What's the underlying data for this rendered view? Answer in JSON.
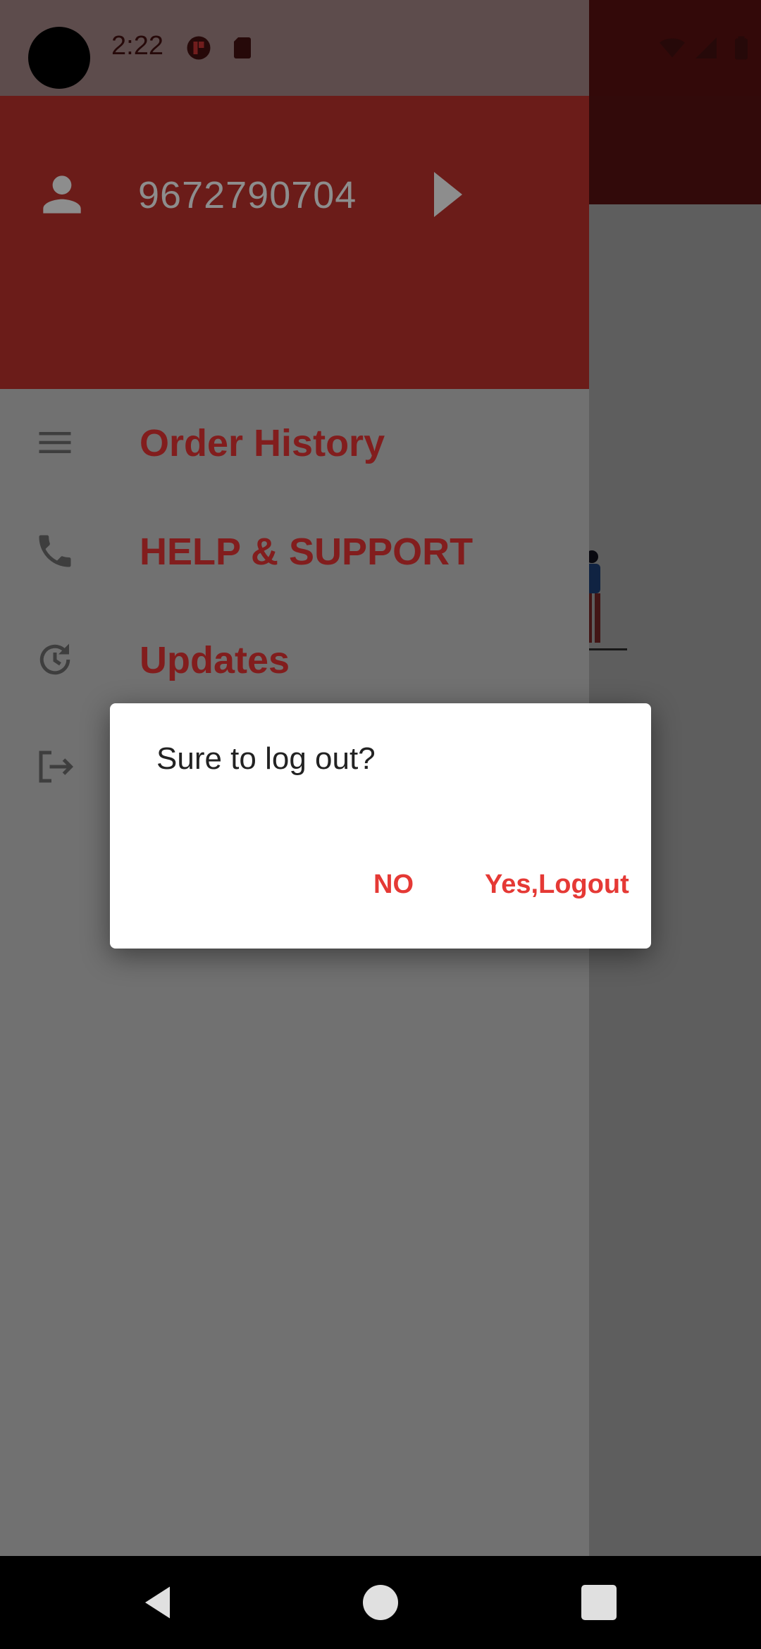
{
  "status_bar": {
    "time": "2:22",
    "icons": [
      "camera-cutout",
      "notification-app-icon",
      "sd-card-icon",
      "wifi-icon",
      "signal-icon",
      "battery-icon"
    ]
  },
  "drawer": {
    "header": {
      "avatar_icon": "person-icon",
      "phone": "9672790704",
      "chevron_icon": "chevron-right-icon"
    },
    "items": [
      {
        "icon": "menu-icon",
        "label": "Order History"
      },
      {
        "icon": "phone-icon",
        "label": "HELP & SUPPORT"
      },
      {
        "icon": "history-icon",
        "label": "Updates"
      },
      {
        "icon": "logout-icon",
        "label": ""
      }
    ]
  },
  "dialog": {
    "title": "Sure to log out?",
    "no_label": "NO",
    "yes_label": "Yes,Logout"
  },
  "colors": {
    "drawer_header": "#751f1c",
    "menu_label": "#8e2020",
    "dialog_action": "#e53935"
  },
  "nav_bar": {
    "icons": [
      "back-icon",
      "home-icon",
      "recents-icon"
    ]
  }
}
